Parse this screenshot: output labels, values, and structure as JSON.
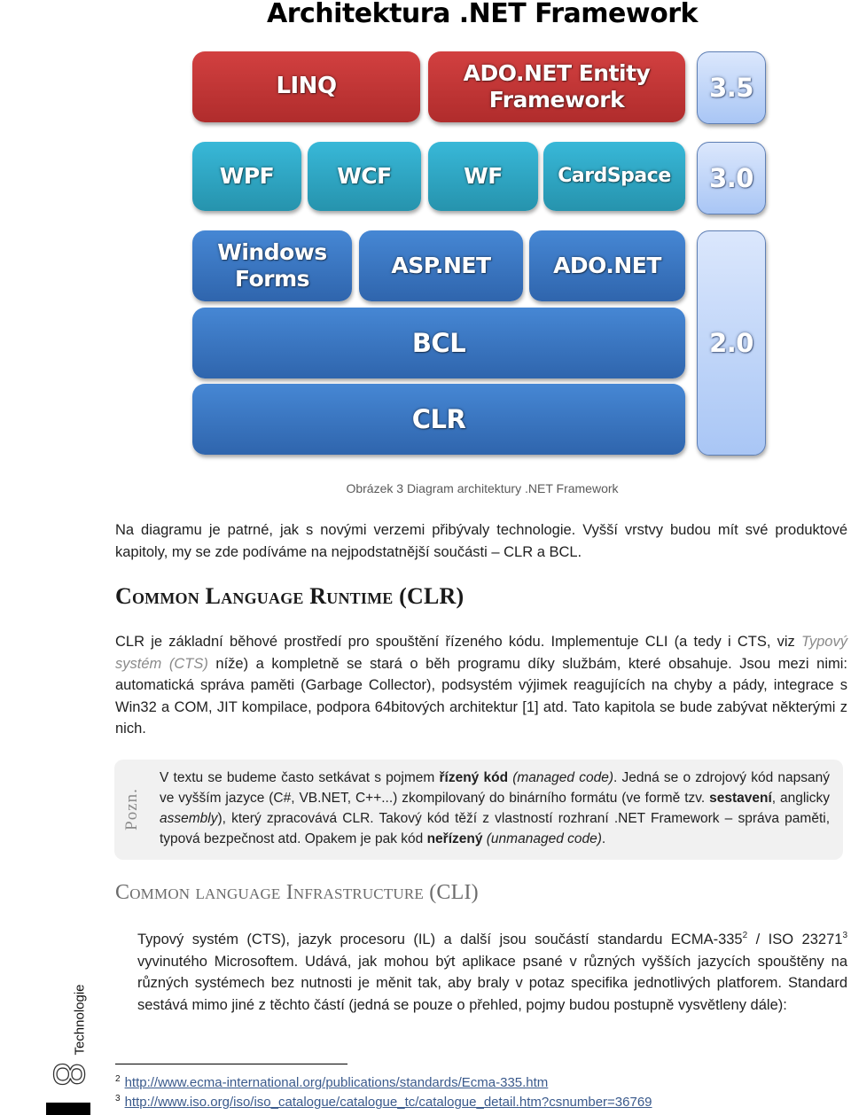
{
  "diagram": {
    "title": "Architektura .NET Framework",
    "layers": {
      "v35": [
        "LINQ",
        "ADO.NET Entity Framework"
      ],
      "v30": [
        "WPF",
        "WCF",
        "WF",
        "CardSpace"
      ],
      "v20": [
        "Windows Forms",
        "ASP.NET",
        "ADO.NET",
        "BCL",
        "CLR"
      ]
    },
    "versions": [
      "3.5",
      "3.0",
      "2.0"
    ],
    "colors": {
      "v35": "#c43636",
      "v30": "#2fa6c4",
      "v20": "#3b76c0",
      "version": "#c2d6f8"
    },
    "caption": "Obrázek 3 Diagram architektury .NET Framework"
  },
  "intro": "Na diagramu je patrné, jak s novými verzemi přibývaly technologie. Vyšší vrstvy budou mít své produktové kapitoly, my se zde podíváme na nejpodstatnější součásti – CLR a BCL.",
  "clr": {
    "heading": "Common Language Runtime (CLR)",
    "p_start": "CLR je základní běhové prostředí pro spouštění řízeného kódu. Implementuje CLI (a tedy i CTS, viz ",
    "p_xref": "Typový systém (CTS)",
    "p_end": " níže) a kompletně se stará o běh programu díky službám, které obsahuje. Jsou mezi nimi: automatická správa paměti (Garbage Collector), podsystém výjimek reagujících na chyby a pády, integrace s Win32 a COM, JIT kompilace, podpora 64bitových architektur [1] atd. Tato kapitola se bude zabývat některými z nich."
  },
  "note": {
    "label": "Pozn.",
    "t1": "V textu se budeme často setkávat s pojmem ",
    "b1": "řízený kód",
    "i1": " (managed code)",
    "t2": ". Jedná se o zdrojový kód napsaný ve vyšším jazyce (C#, VB.NET, C++...) zkompilovaný do binárního formátu (ve formě tzv. ",
    "b2": "sestavení",
    "t3": ", anglicky ",
    "i2": "assembly",
    "t4": "), který zpracovává CLR. Takový kód těží z vlastností rozhraní .NET Framework – správa paměti, typová bezpečnost atd. Opakem je pak kód ",
    "b3": "neřízený",
    "i3": " (unmanaged code)",
    "t5": "."
  },
  "cli": {
    "heading": "Common language Infrastructure (CLI)",
    "p_a": "Typový systém (CTS), jazyk procesoru (IL) a další jsou součástí standardu ECMA-335",
    "sup2": "2",
    "p_b": " / ISO 23271",
    "sup3": "3",
    "p_c": " vyvinutého Microsoftem. Udává, jak mohou být aplikace psané v různých vyšších jazycích spouštěny na různých systémech bez nutnosti je měnit tak, aby braly v potaz specifika jednotlivých platforem. Standard sestává mimo jiné z těchto částí (jedná se pouze o přehled, pojmy budou postupně vysvětleny dále):"
  },
  "sidebar": {
    "section": "Technologie",
    "page_number": "8"
  },
  "footnotes": [
    {
      "num": "2",
      "url": "http://www.ecma-international.org/publications/standards/Ecma-335.htm"
    },
    {
      "num": "3",
      "url": "http://www.iso.org/iso/iso_catalogue/catalogue_tc/catalogue_detail.htm?csnumber=36769"
    }
  ]
}
